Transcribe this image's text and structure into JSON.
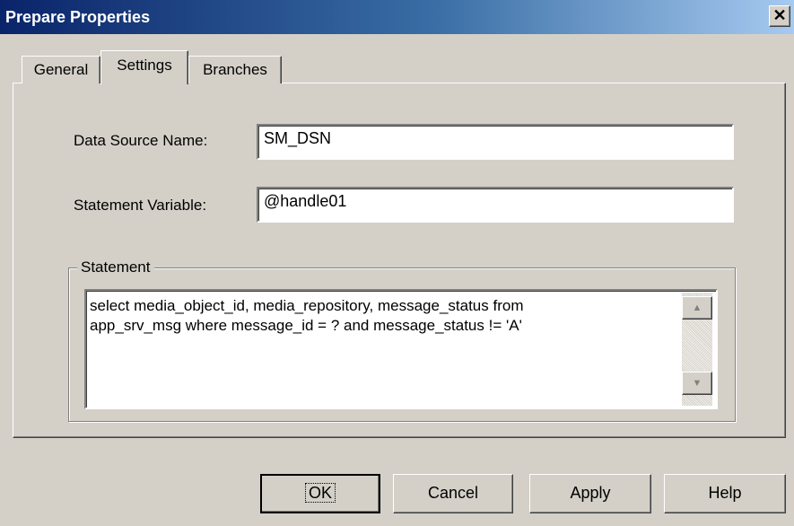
{
  "window": {
    "title": "Prepare Properties",
    "close_glyph": "✕"
  },
  "tabs": [
    {
      "label": "General"
    },
    {
      "label": "Settings",
      "selected": true
    },
    {
      "label": "Branches"
    }
  ],
  "form": {
    "dsn_label": "Data Source Name:",
    "dsn_value": "SM_DSN",
    "statement_var_label": "Statement Variable:",
    "statement_var_value": "@handle01",
    "statement_group_label": "Statement",
    "statement_text": "select media_object_id, media_repository, message_status from\napp_srv_msg where message_id = ? and message_status != 'A'"
  },
  "scrollbar": {
    "up_glyph": "▲",
    "down_glyph": "▼"
  },
  "buttons": {
    "ok": "OK",
    "cancel": "Cancel",
    "apply": "Apply",
    "help": "Help"
  }
}
